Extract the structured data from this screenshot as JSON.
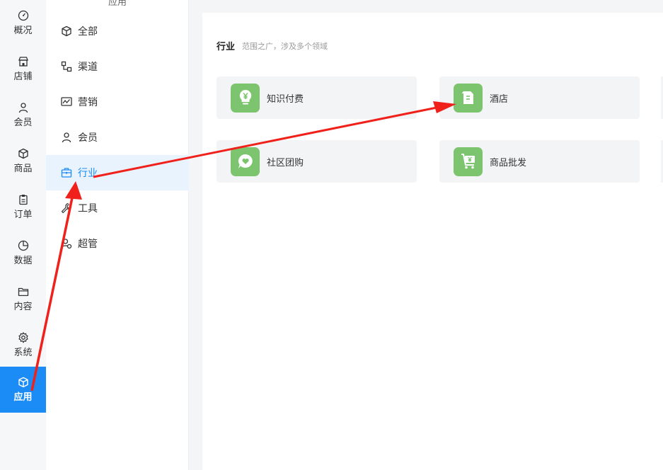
{
  "rail": {
    "items": [
      {
        "label": "概况",
        "icon": "dashboard-gauge-icon"
      },
      {
        "label": "店铺",
        "icon": "storefront-icon"
      },
      {
        "label": "会员",
        "icon": "user-icon"
      },
      {
        "label": "商品",
        "icon": "cube-icon"
      },
      {
        "label": "订单",
        "icon": "clipboard-icon"
      },
      {
        "label": "数据",
        "icon": "pie-chart-icon"
      },
      {
        "label": "内容",
        "icon": "folder-icon"
      },
      {
        "label": "系统",
        "icon": "gear-icon"
      },
      {
        "label": "应用",
        "icon": "cube-icon",
        "active": true
      }
    ],
    "active_color": "#1b8cf5"
  },
  "sub": {
    "header": "应用",
    "items": [
      {
        "label": "全部",
        "icon": "cube-icon"
      },
      {
        "label": "渠道",
        "icon": "channel-nodes-icon"
      },
      {
        "label": "营销",
        "icon": "trend-monitor-icon"
      },
      {
        "label": "会员",
        "icon": "user-icon"
      },
      {
        "label": "行业",
        "icon": "briefcase-icon",
        "active": true
      },
      {
        "label": "工具",
        "icon": "wrench-icon"
      },
      {
        "label": "超管",
        "icon": "admin-user-icon"
      }
    ]
  },
  "main": {
    "section_title": "行业",
    "section_subtitle": "范围之广，涉及多个领域",
    "cards": [
      {
        "label": "知识付费",
        "icon": "lightbulb-yen-icon"
      },
      {
        "label": "酒店",
        "icon": "hotel-document-icon"
      },
      {
        "label": "社区团购",
        "icon": "chat-heart-icon"
      },
      {
        "label": "商品批发",
        "icon": "wholesale-cart-icon"
      }
    ],
    "card_icon_color": "#7cc46e"
  },
  "annotation": {
    "arrow_color": "#f0211b"
  }
}
